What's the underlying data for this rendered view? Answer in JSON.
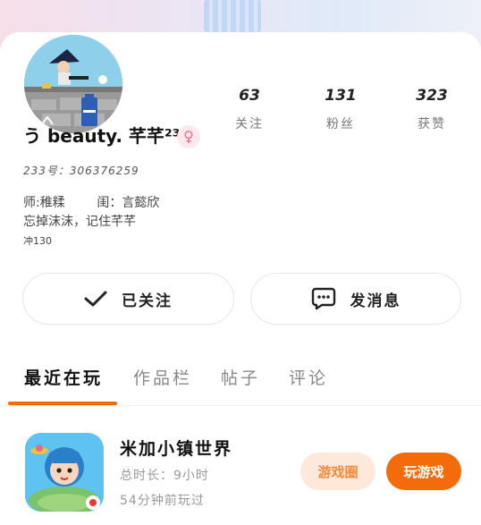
{
  "profile": {
    "username": "う beauty. 芊芊²³³",
    "gender_symbol": "♀",
    "uid_line": "233号：306376259",
    "bio": [
      "师:稚糅        闺：言懿欣",
      "忘掉沫沫，记住芊芊",
      "冲130"
    ]
  },
  "stats": [
    {
      "value": "63",
      "label": "关注"
    },
    {
      "value": "131",
      "label": "粉丝"
    },
    {
      "value": "323",
      "label": "获赞"
    }
  ],
  "actions": {
    "follow_label": "已关注",
    "message_label": "发消息"
  },
  "tabs": [
    {
      "label": "最近在玩",
      "active": true
    },
    {
      "label": "作品栏",
      "active": false
    },
    {
      "label": "帖子",
      "active": false
    },
    {
      "label": "评论",
      "active": false
    }
  ],
  "recent_game": {
    "title": "米加小镇世界",
    "duration": "总时长：9小时",
    "last_played": "54分钟前玩过",
    "circle_label": "游戏圈",
    "play_label": "玩游戏"
  },
  "colors": {
    "accent": "#f46b0c",
    "accent_light": "#fde8da",
    "gender_pink": "#f06a90"
  },
  "icons": {
    "follow": "check-icon",
    "message": "chat-bubble-icon",
    "gender": "female-icon"
  }
}
